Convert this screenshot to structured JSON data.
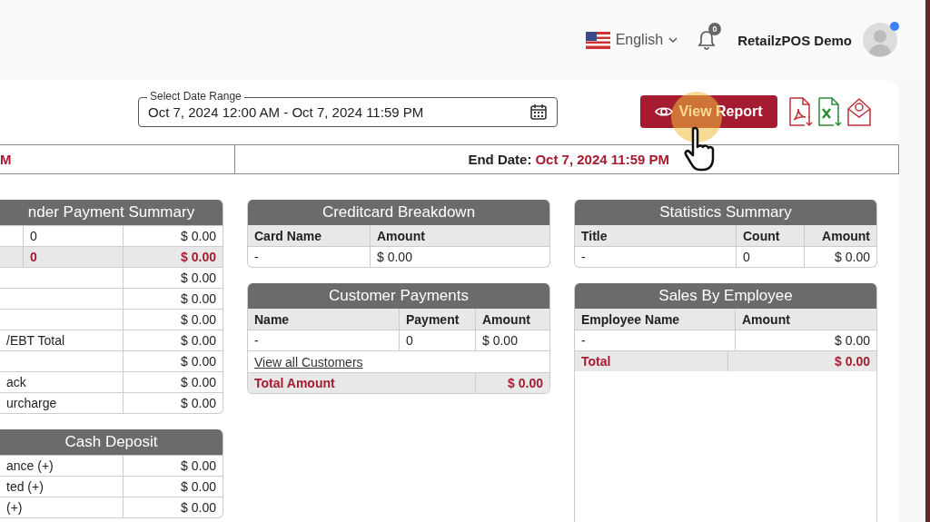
{
  "header": {
    "language": {
      "label": "English"
    },
    "notifications": {
      "count": "0"
    },
    "user": {
      "name": "RetailzPOS Demo",
      "online": true
    }
  },
  "toolbar": {
    "date_range": {
      "label": "Select Date Range",
      "value": "Oct 7, 2024 12:00 AM - Oct 7, 2024 11:59 PM"
    },
    "view_report_button": "View Report"
  },
  "date_bar": {
    "start_value": "M",
    "end_label": "End Date:",
    "end_value": "Oct 7, 2024 11:59 PM"
  },
  "panel_columns": [
    [
      {
        "kind": "tender",
        "title": "nder Payment Summary",
        "rows": [
          {
            "kind": "data",
            "count": "0",
            "amount": "$ 0.00"
          },
          {
            "kind": "total",
            "count": "0",
            "amount": "$ 0.00"
          },
          {
            "kind": "data",
            "amount": "$ 0.00"
          },
          {
            "kind": "data",
            "amount": "$ 0.00"
          },
          {
            "kind": "data",
            "amount": "$ 0.00"
          },
          {
            "kind": "data",
            "name": "/EBT Total",
            "amount": "$ 0.00"
          },
          {
            "kind": "data",
            "amount": "$ 0.00"
          },
          {
            "kind": "data",
            "name": "ack",
            "amount": "$ 0.00"
          },
          {
            "kind": "data",
            "name": "urcharge",
            "amount": "$ 0.00"
          }
        ]
      },
      {
        "kind": "cash",
        "title": "Cash Deposit",
        "rows": [
          {
            "kind": "data",
            "name": "ance (+)",
            "amount": "$ 0.00"
          },
          {
            "kind": "data",
            "name": "ted (+)",
            "amount": "$ 0.00"
          },
          {
            "kind": "data",
            "name": "(+)",
            "amount": "$ 0.00"
          }
        ]
      }
    ],
    [
      {
        "kind": "creditcard",
        "title": "Creditcard Breakdown",
        "columns": [
          "Card Name",
          "Amount"
        ],
        "rows": [
          {
            "kind": "data",
            "name": "-",
            "amount": "$ 0.00"
          }
        ]
      },
      {
        "kind": "customers",
        "title": "Customer Payments",
        "columns": [
          "Name",
          "Payment",
          "Amount"
        ],
        "rows": [
          {
            "kind": "data",
            "name": "-",
            "count": "0",
            "amount": "$ 0.00"
          },
          {
            "kind": "link",
            "name": "View all Customers"
          },
          {
            "kind": "total",
            "name": "Total Amount",
            "amount": "$ 0.00"
          }
        ]
      }
    ],
    [
      {
        "kind": "statistics",
        "title": "Statistics Summary",
        "columns": [
          "Title",
          "Count",
          "Amount"
        ],
        "rows": [
          {
            "kind": "data",
            "name": "-",
            "count": "0",
            "amount": "$ 0.00"
          }
        ]
      },
      {
        "kind": "employee",
        "title": "Sales By Employee",
        "columns": [
          "Employee Name",
          "Amount"
        ],
        "rows": [
          {
            "kind": "data",
            "name": "-",
            "amount": "$ 0.00"
          },
          {
            "kind": "total",
            "name": "Total",
            "amount": "$ 0.00"
          }
        ]
      }
    ]
  ]
}
